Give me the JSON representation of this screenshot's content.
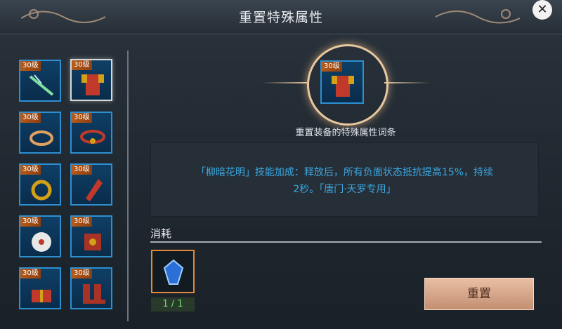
{
  "header": {
    "title": "重置特殊属性"
  },
  "slots": [
    {
      "level": "30级",
      "icon": "blade-icon"
    },
    {
      "level": "30级",
      "icon": "armor-icon"
    },
    {
      "level": "30级",
      "icon": "waist-sash-icon"
    },
    {
      "level": "30级",
      "icon": "belt-icon"
    },
    {
      "level": "30级",
      "icon": "ring-icon"
    },
    {
      "level": "30级",
      "icon": "bracer-icon"
    },
    {
      "level": "30级",
      "icon": "pendant-icon"
    },
    {
      "level": "30级",
      "icon": "shoulder-icon"
    },
    {
      "level": "30级",
      "icon": "gift-box-icon"
    },
    {
      "level": "30级",
      "icon": "boots-icon"
    }
  ],
  "selected": {
    "level": "30级",
    "icon": "armor-icon"
  },
  "main": {
    "subtitle": "重置装备的特殊属性词条",
    "description_line1": "「柳暗花明」技能加成：释放后，所有负面状态抵抗提高15%，持续",
    "description_line2": "2秒。「唐门·天罗专用」"
  },
  "cost": {
    "label": "消耗",
    "count": "1 / 1",
    "icon": "crystal-icon"
  },
  "button": {
    "reset_label": "重置"
  },
  "colors": {
    "accent_blue": "#3aa7e0",
    "slot_border": "#2d8fd0",
    "level_badge": "#b55a1a",
    "button": "#d6a68a"
  }
}
